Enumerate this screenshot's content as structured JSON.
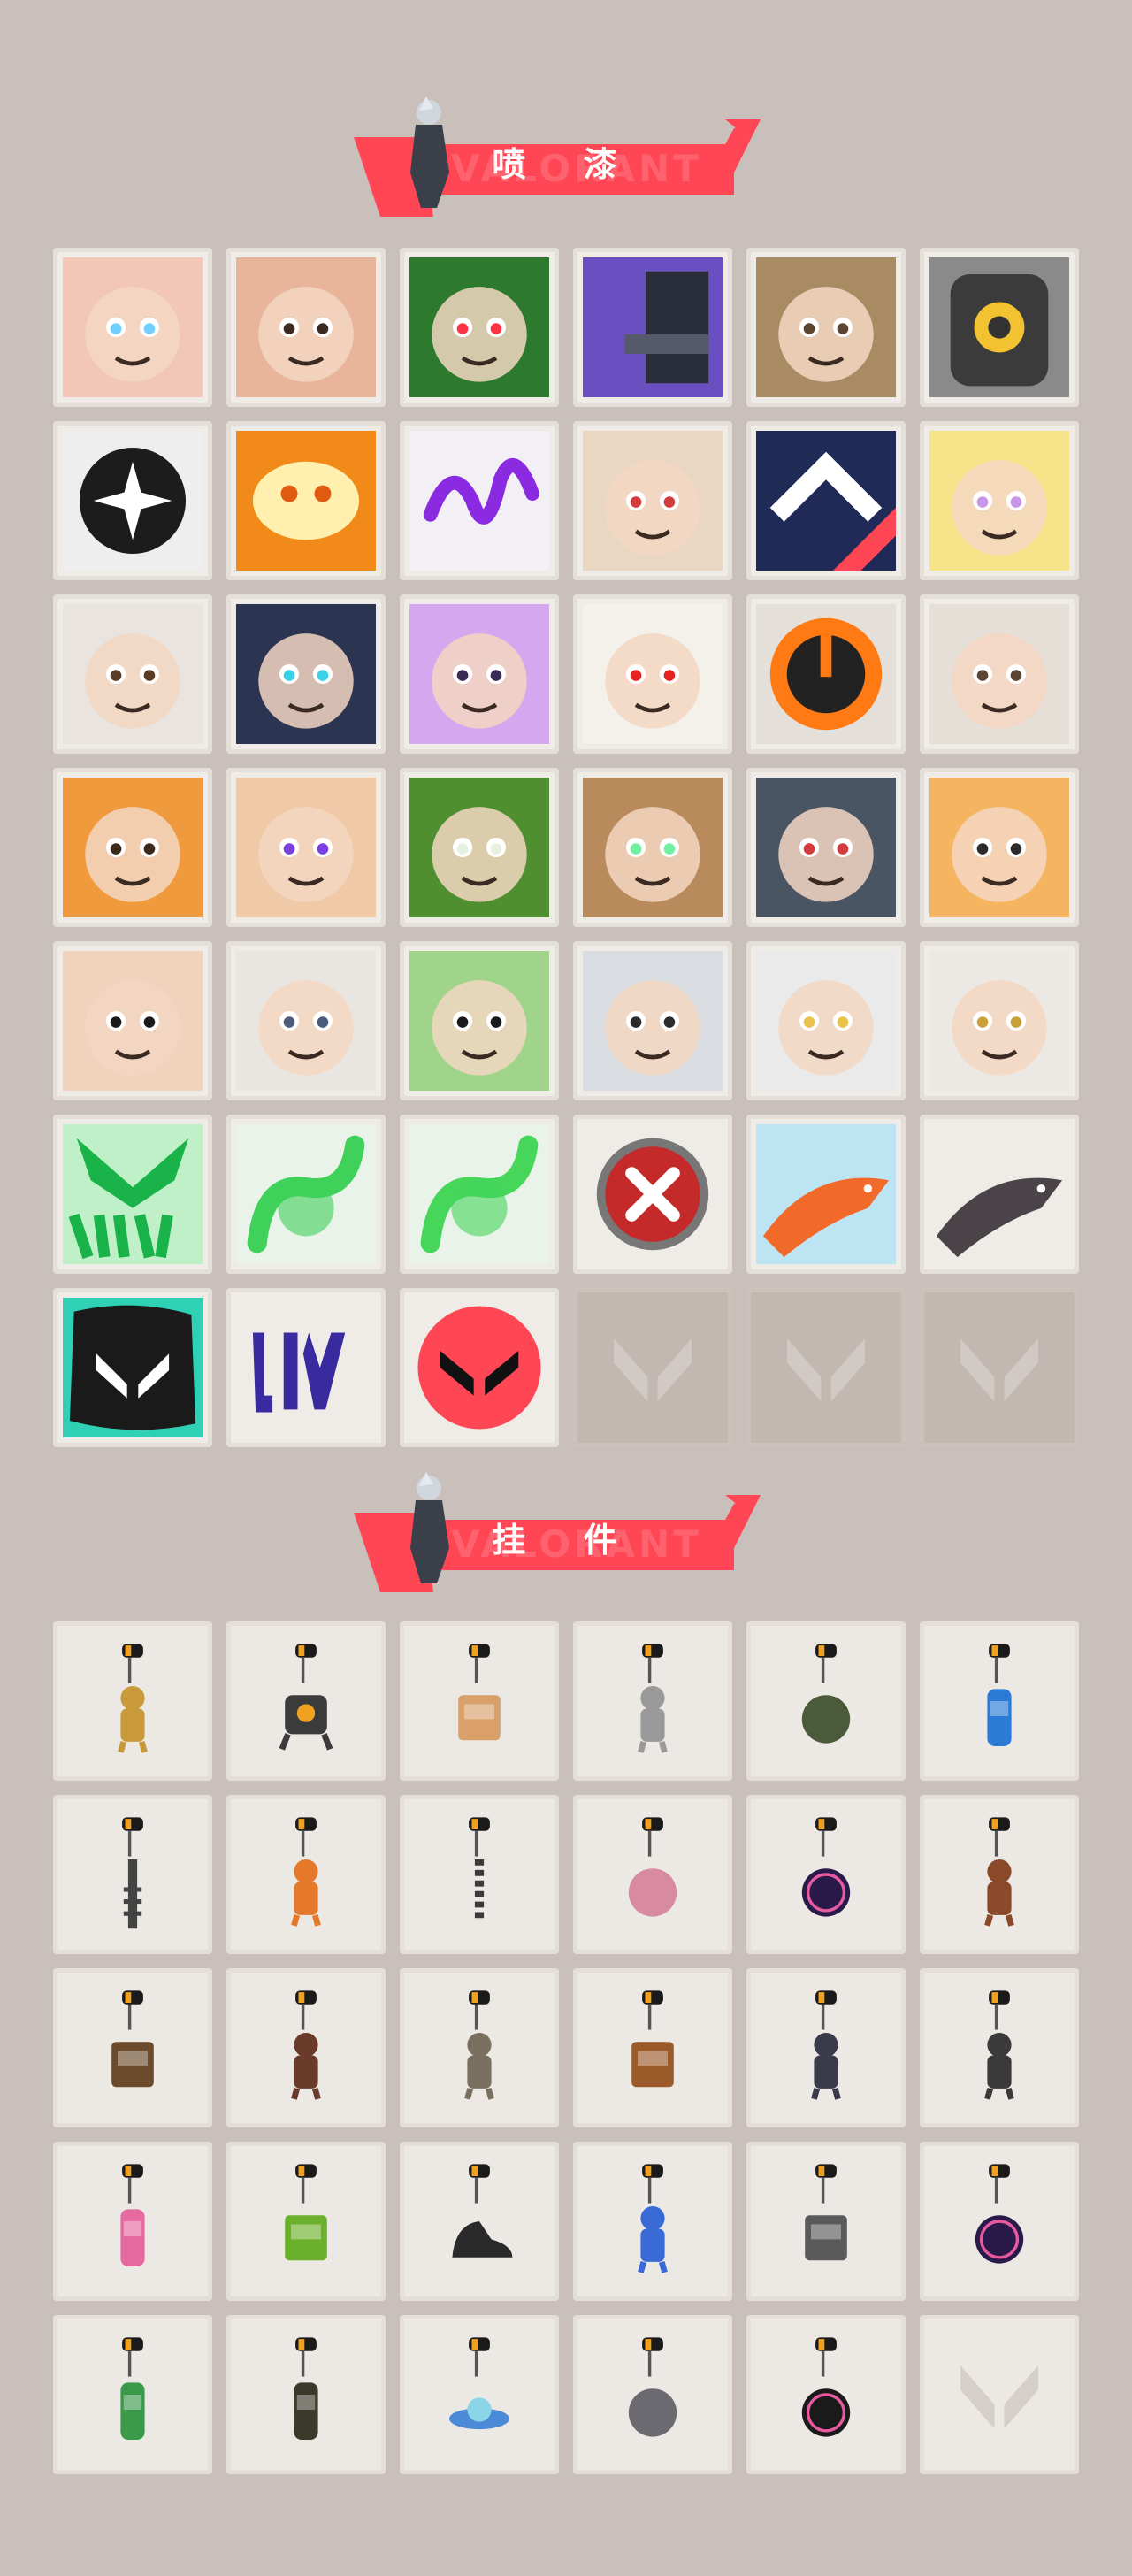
{
  "sections": {
    "sprays": {
      "title": "喷  漆",
      "banner_text": "VALORANT"
    },
    "buddies": {
      "title": "挂  件",
      "banner_text": "VALORANT"
    }
  },
  "colors": {
    "background": "#c9c0bb",
    "accent": "#ff4655",
    "tile": "#efece8",
    "empty_tile": "#c2b8b1"
  },
  "sprays": [
    {
      "name": "face-butterfly",
      "kind": "face",
      "bg": "#f2c7b8",
      "accent": "#6fd0ff"
    },
    {
      "name": "angry-face",
      "kind": "face",
      "bg": "#e8b59a",
      "accent": "#3a2a22"
    },
    {
      "name": "green-masked-agent",
      "kind": "mask",
      "bg": "#2d7a2f",
      "accent": "#ff3344"
    },
    {
      "name": "purple-gun",
      "kind": "gun",
      "bg": "#6a4fc0",
      "accent": "#2a2d3a"
    },
    {
      "name": "beanie-penguin",
      "kind": "penguin",
      "bg": "#a88a63",
      "accent": "#5a4630"
    },
    {
      "name": "yellow-eye-robot",
      "kind": "robot",
      "bg": "#3b3b3b",
      "accent": "#f2c230"
    },
    {
      "name": "black-star-emblem",
      "kind": "emblem",
      "bg": "#1c1c1c",
      "accent": "#ffffff"
    },
    {
      "name": "orange-gold-crest",
      "kind": "crest",
      "bg": "#f28a1a",
      "accent": "#fff0b0"
    },
    {
      "name": "purple-scribble",
      "kind": "scribble",
      "bg": "#f3f0f5",
      "accent": "#8a2be2"
    },
    {
      "name": "goggles-cat",
      "kind": "cat",
      "bg": "#e9d7c3",
      "accent": "#d23c3c"
    },
    {
      "name": "navy-chevrons",
      "kind": "chevron",
      "bg": "#1f2a57",
      "accent": "#ff4655"
    },
    {
      "name": "unicorn-shark",
      "kind": "unicorn",
      "bg": "#f7e38a",
      "accent": "#c995e8"
    },
    {
      "name": "pixel-agent",
      "kind": "pixel",
      "bg": "#e9e4df",
      "accent": "#5a3b24"
    },
    {
      "name": "armored-helmet",
      "kind": "helmet",
      "bg": "#2b3450",
      "accent": "#3ad0e8"
    },
    {
      "name": "purple-blob",
      "kind": "blob",
      "bg": "#d4a7ee",
      "accent": "#3b2a55"
    },
    {
      "name": "clown-face",
      "kind": "clown",
      "bg": "#f4f0ea",
      "accent": "#e5241f"
    },
    {
      "name": "orange-target",
      "kind": "target",
      "bg": "#222222",
      "accent": "#ff7a12"
    },
    {
      "name": "sunglasses-bear",
      "kind": "bear",
      "bg": "#e6dfd8",
      "accent": "#5b4535"
    },
    {
      "name": "bearded-dwarf",
      "kind": "dwarf",
      "bg": "#f09a3e",
      "accent": "#3a2a1a"
    },
    {
      "name": "purple-eyes-boy",
      "kind": "boy",
      "bg": "#f0c9a6",
      "accent": "#7a3fe0"
    },
    {
      "name": "green-crate",
      "kind": "crate",
      "bg": "#4f8f2f",
      "accent": "#e8f0e0"
    },
    {
      "name": "green-eyed-creature",
      "kind": "creature",
      "bg": "#b88a5c",
      "accent": "#6ff0a0"
    },
    {
      "name": "crying-seal",
      "kind": "seal",
      "bg": "#4a5564",
      "accent": "#d23c3c"
    },
    {
      "name": "sleepy-tiger",
      "kind": "tiger",
      "bg": "#f5b560",
      "accent": "#2b2b2b"
    },
    {
      "name": "girl-face",
      "kind": "girl",
      "bg": "#f1d2bd",
      "accent": "#1a1a1a"
    },
    {
      "name": "beanie-penguin-2",
      "kind": "penguin2",
      "bg": "#e9e6e1",
      "accent": "#4a5a78"
    },
    {
      "name": "top-hat-frog",
      "kind": "frog",
      "bg": "#9fd48a",
      "accent": "#1a1a1a"
    },
    {
      "name": "pixel-raccoon",
      "kind": "raccoon",
      "bg": "#d9dde2",
      "accent": "#2b2b2b"
    },
    {
      "name": "two-faces",
      "kind": "twofaces",
      "bg": "#eaeaea",
      "accent": "#e8c24a"
    },
    {
      "name": "gold-profile",
      "kind": "profile",
      "bg": "#ece8e3",
      "accent": "#c8a13a"
    },
    {
      "name": "viper-graffiti",
      "kind": "viper",
      "bg": "#bff0c8",
      "accent": "#19b34a"
    },
    {
      "name": "green-snake-smoke",
      "kind": "snake",
      "bg": "#e9f3e9",
      "accent": "#3fd15a"
    },
    {
      "name": "green-orb",
      "kind": "orb",
      "bg": "#e9f3e9",
      "accent": "#45d65a"
    },
    {
      "name": "red-x-badge",
      "kind": "xbadge",
      "bg": "#efece8",
      "accent": "#c42a2a"
    },
    {
      "name": "orange-koi",
      "kind": "koi",
      "bg": "#bde4f2",
      "accent": "#f26a2a"
    },
    {
      "name": "grey-koi",
      "kind": "koi2",
      "bg": "#efece8",
      "accent": "#4a4448"
    },
    {
      "name": "teal-v-splash",
      "kind": "vsplash",
      "bg": "#2fd1b5",
      "accent": "#1a1a1a"
    },
    {
      "name": "purple-drip-tag",
      "kind": "drip",
      "bg": "#efece8",
      "accent": "#3a2aa0"
    },
    {
      "name": "red-v-circle",
      "kind": "vcircle",
      "bg": "#efece8",
      "accent": "#ff4655"
    },
    {
      "name": "empty-slot-1",
      "kind": "empty",
      "bg": "#c2b8b1",
      "accent": "#d3cbc5"
    },
    {
      "name": "empty-slot-2",
      "kind": "empty",
      "bg": "#c2b8b1",
      "accent": "#d3cbc5"
    },
    {
      "name": "empty-slot-3",
      "kind": "empty",
      "bg": "#c2b8b1",
      "accent": "#d3cbc5"
    }
  ],
  "buddies": [
    {
      "name": "gold-lion-figure",
      "body": "#c99a3a",
      "shape": "figure"
    },
    {
      "name": "drone-bot",
      "body": "#3b3b3b",
      "shape": "bot"
    },
    {
      "name": "blue-pack",
      "body": "#d9a06a",
      "shape": "box"
    },
    {
      "name": "cat-figure",
      "body": "#9a9a9a",
      "shape": "figure"
    },
    {
      "name": "round-pouch",
      "body": "#4a5a3a",
      "shape": "round"
    },
    {
      "name": "blue-canister",
      "body": "#2a7ad6",
      "shape": "bottle"
    },
    {
      "name": "spiked-club",
      "body": "#444444",
      "shape": "club"
    },
    {
      "name": "orange-bird",
      "body": "#e6782a",
      "shape": "figure"
    },
    {
      "name": "rope-charm",
      "body": "#3a3a3a",
      "shape": "rope"
    },
    {
      "name": "cupcake",
      "body": "#d88aa0",
      "shape": "round"
    },
    {
      "name": "ep9-disc",
      "body": "#2a1a4a",
      "shape": "disc"
    },
    {
      "name": "teddy-bear",
      "body": "#8a4a2a",
      "shape": "figure"
    },
    {
      "name": "wood-contraption",
      "body": "#6a4a2a",
      "shape": "box"
    },
    {
      "name": "agent-figure",
      "body": "#6a3a2a",
      "shape": "figure"
    },
    {
      "name": "hat-figure",
      "body": "#7a7060",
      "shape": "figure"
    },
    {
      "name": "wood-crate",
      "body": "#9a5a2a",
      "shape": "box"
    },
    {
      "name": "dark-figure",
      "body": "#3a3a4a",
      "shape": "figure"
    },
    {
      "name": "black-cat",
      "body": "#3a3a3a",
      "shape": "figure"
    },
    {
      "name": "lava-lamp",
      "body": "#e66aa0",
      "shape": "bottle"
    },
    {
      "name": "green-pager",
      "body": "#6ab02a",
      "shape": "box"
    },
    {
      "name": "black-sneaker",
      "body": "#2a2a2a",
      "shape": "shoe"
    },
    {
      "name": "astronaut",
      "body": "#3a6ad6",
      "shape": "figure"
    },
    {
      "name": "radio-pack",
      "body": "#5a5a5a",
      "shape": "box"
    },
    {
      "name": "ep9-disc-2",
      "body": "#2a1a4a",
      "shape": "disc"
    },
    {
      "name": "green-can",
      "body": "#3a9a4a",
      "shape": "bottle"
    },
    {
      "name": "lantern",
      "body": "#3a3a2a",
      "shape": "bottle"
    },
    {
      "name": "ufo",
      "body": "#4a8ad6",
      "shape": "ufo"
    },
    {
      "name": "grey-cat-head",
      "body": "#6a6a70",
      "shape": "round"
    },
    {
      "name": "v-medal",
      "body": "#1a1a1a",
      "shape": "disc"
    },
    {
      "name": "empty-slot",
      "body": "#c2b8b1",
      "shape": "empty"
    }
  ]
}
